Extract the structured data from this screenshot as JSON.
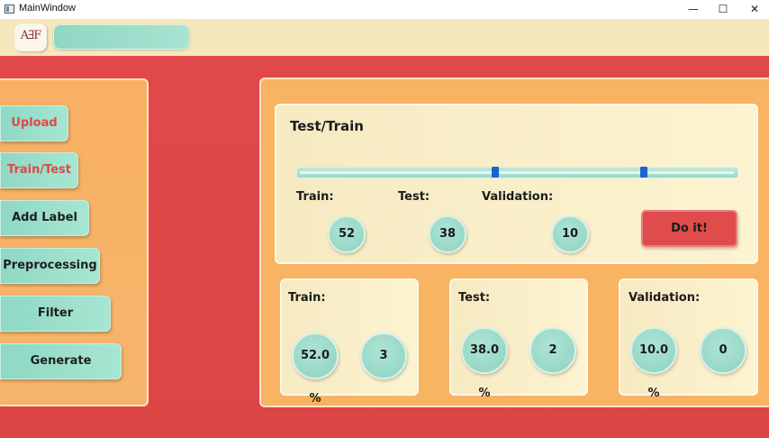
{
  "window": {
    "title": "MainWindow",
    "minimize_glyph": "—",
    "maximize_glyph": "☐",
    "close_glyph": "✕"
  },
  "toolbar": {
    "logo_text": "A∃F",
    "search_value": ""
  },
  "sidebar": {
    "items": [
      {
        "label": "Upload",
        "active": true
      },
      {
        "label": "Train/Test",
        "active": true
      },
      {
        "label": "Add Label",
        "active": false
      },
      {
        "label": "Preprocessing",
        "active": false
      },
      {
        "label": "Filter",
        "active": false
      },
      {
        "label": "Generate",
        "active": false
      }
    ]
  },
  "split": {
    "title": "Test/Train",
    "slider_handles": [
      0.44,
      0.78
    ],
    "train_label": "Train:",
    "test_label": "Test:",
    "validation_label": "Validation:",
    "train_value": "52",
    "test_value": "38",
    "validation_value": "10",
    "action_label": "Do it!"
  },
  "results": {
    "train": {
      "label": "Train:",
      "percent": "52.0 %",
      "count": "3"
    },
    "test": {
      "label": "Test:",
      "percent": "38.0 %",
      "count": "2"
    },
    "validation": {
      "label": "Validation:",
      "percent": "10.0 %",
      "count": "0"
    }
  },
  "colors": {
    "accent_red": "#e04848",
    "panel_orange": "#f8b363",
    "mint": "#9fdcc9",
    "handle_blue": "#1a63d1"
  }
}
